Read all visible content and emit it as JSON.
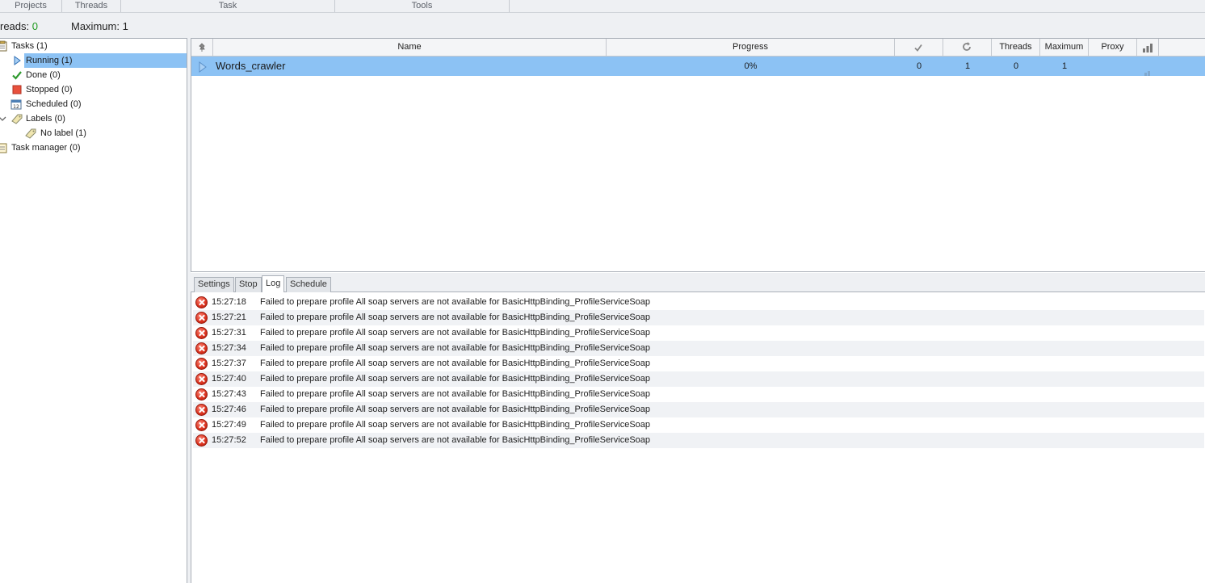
{
  "ribbon": {
    "groups": [
      "Projects",
      "Threads",
      "Task",
      "Tools"
    ]
  },
  "status": {
    "threads_label": "reads:",
    "threads_value": "0",
    "maximum_label": "Maximum:",
    "maximum_value": "1"
  },
  "tree": {
    "tasks": "Tasks (1)",
    "running": "Running (1)",
    "done": "Done (0)",
    "stopped": "Stopped (0)",
    "scheduled": "Scheduled (0)",
    "labels": "Labels (0)",
    "no_label": "No label (1)",
    "task_manager": "Task manager (0)"
  },
  "grid": {
    "columns": {
      "name": "Name",
      "progress": "Progress",
      "threads": "Threads",
      "maximum": "Maximum",
      "proxy": "Proxy"
    },
    "row": {
      "name": "Words_crawler",
      "progress": "0%",
      "success": "0",
      "repeat": "1",
      "threads": "0",
      "maximum": "1",
      "proxy": ""
    }
  },
  "tabs": [
    "Settings",
    "Stop",
    "Log",
    "Schedule"
  ],
  "log": [
    {
      "time": "15:27:18",
      "message": "Failed to prepare profile All soap servers are not available for BasicHttpBinding_ProfileServiceSoap"
    },
    {
      "time": "15:27:21",
      "message": "Failed to prepare profile All soap servers are not available for BasicHttpBinding_ProfileServiceSoap"
    },
    {
      "time": "15:27:31",
      "message": "Failed to prepare profile All soap servers are not available for BasicHttpBinding_ProfileServiceSoap"
    },
    {
      "time": "15:27:34",
      "message": "Failed to prepare profile All soap servers are not available for BasicHttpBinding_ProfileServiceSoap"
    },
    {
      "time": "15:27:37",
      "message": "Failed to prepare profile All soap servers are not available for BasicHttpBinding_ProfileServiceSoap"
    },
    {
      "time": "15:27:40",
      "message": "Failed to prepare profile All soap servers are not available for BasicHttpBinding_ProfileServiceSoap"
    },
    {
      "time": "15:27:43",
      "message": "Failed to prepare profile All soap servers are not available for BasicHttpBinding_ProfileServiceSoap"
    },
    {
      "time": "15:27:46",
      "message": "Failed to prepare profile All soap servers are not available for BasicHttpBinding_ProfileServiceSoap"
    },
    {
      "time": "15:27:49",
      "message": "Failed to prepare profile All soap servers are not available for BasicHttpBinding_ProfileServiceSoap"
    },
    {
      "time": "15:27:52",
      "message": "Failed to prepare profile All soap servers are not available for BasicHttpBinding_ProfileServiceSoap"
    }
  ]
}
